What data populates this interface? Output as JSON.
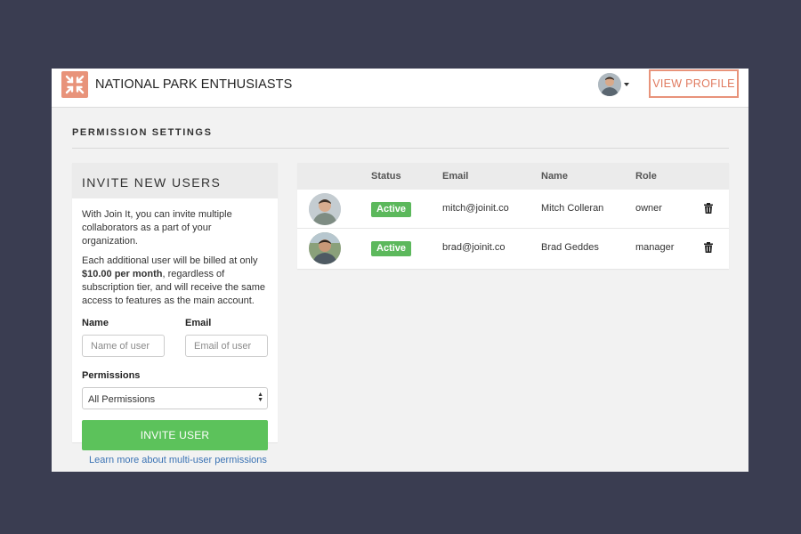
{
  "header": {
    "org_name": "NATIONAL PARK ENTHUSIASTS",
    "logo_icon": "compress-arrows-icon",
    "view_profile_label": "VIEW PROFILE",
    "brand_color": "#e8937a"
  },
  "page": {
    "section_title": "PERMISSION SETTINGS"
  },
  "invite": {
    "title": "INVITE NEW USERS",
    "intro": "With Join It, you can invite multiple collaborators as a part of your organization.",
    "billing_prefix": "Each additional user will be billed at only ",
    "billing_price": "$10.00 per month",
    "billing_suffix": ", regardless of subscription tier, and will receive the same access to features as the main account.",
    "name_label": "Name",
    "name_placeholder": "Name of user",
    "email_label": "Email",
    "email_placeholder": "Email of user",
    "permissions_label": "Permissions",
    "permissions_selected": "All Permissions",
    "submit_label": "INVITE USER",
    "button_color": "#5cc25b"
  },
  "learn_more_link": "Learn more about multi-user permissions",
  "users_table": {
    "columns": [
      "Status",
      "Email",
      "Name",
      "Role"
    ],
    "rows": [
      {
        "status": "Active",
        "email": "mitch@joinit.co",
        "name": "Mitch Colleran",
        "role": "owner"
      },
      {
        "status": "Active",
        "email": "brad@joinit.co",
        "name": "Brad Geddes",
        "role": "manager"
      }
    ],
    "status_color": "#5cb85c"
  }
}
